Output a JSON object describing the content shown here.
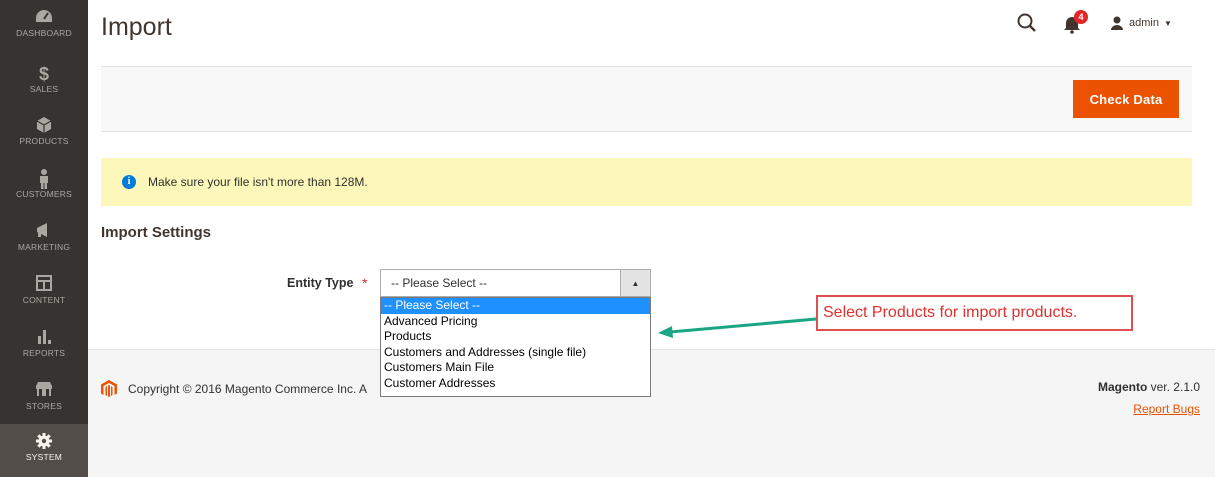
{
  "sidebar": {
    "items": [
      {
        "label": "DASHBOARD",
        "icon": "dashboard-icon"
      },
      {
        "label": "SALES",
        "icon": "dollar-icon"
      },
      {
        "label": "PRODUCTS",
        "icon": "cube-icon"
      },
      {
        "label": "CUSTOMERS",
        "icon": "person-icon"
      },
      {
        "label": "MARKETING",
        "icon": "megaphone-icon"
      },
      {
        "label": "CONTENT",
        "icon": "layout-icon"
      },
      {
        "label": "REPORTS",
        "icon": "bar-chart-icon"
      },
      {
        "label": "STORES",
        "icon": "store-icon"
      },
      {
        "label": "SYSTEM",
        "icon": "gear-icon",
        "active": true
      }
    ]
  },
  "header": {
    "title": "Import",
    "notifications_count": "4",
    "user": "admin"
  },
  "actions": {
    "check_data_label": "Check Data"
  },
  "notice": {
    "text": "Make sure your file isn't more than 128M.",
    "icon_text": "i"
  },
  "section": {
    "title": "Import Settings"
  },
  "entity_type": {
    "label": "Entity Type",
    "required_mark": "*",
    "selected": "-- Please Select --",
    "options": [
      "-- Please Select --",
      "Advanced Pricing",
      "Products",
      "Customers and Addresses (single file)",
      "Customers Main File",
      "Customer Addresses"
    ]
  },
  "annotation": {
    "text": "Select Products for import products."
  },
  "footer": {
    "copyright": "Copyright © 2016 Magento Commerce Inc. A",
    "brand": "Magento",
    "version": " ver. 2.1.0",
    "report_bugs": "Report Bugs"
  },
  "colors": {
    "sidebar_bg": "#373330",
    "accent": "#eb5202",
    "notice_bg": "#fdf8ba",
    "annotation": "#e05050",
    "arrow": "#1aa585"
  }
}
